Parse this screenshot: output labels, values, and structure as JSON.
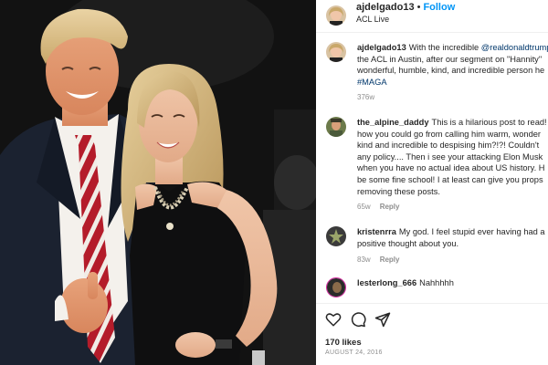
{
  "header": {
    "username": "ajdelgado13",
    "separator": "•",
    "follow_label": "Follow",
    "subtitle": "ACL Live",
    "avatar_icon": "profile-photo"
  },
  "caption": {
    "username": "ajdelgado13",
    "lines": [
      "With the incredible ",
      "the ACL in Austin, after our segment on \"Hannity\"",
      "wonderful, humble, kind, and incredible person he",
      "#MAGA"
    ],
    "mention": "@realdonaldtrump",
    "time": "376w"
  },
  "comments": [
    {
      "username": "the_alpine_daddy",
      "lines": [
        "This is a hilarious post to read!",
        "how you could go from calling him warm, wonder",
        "kind and incredible to despising him?!?! Couldn't",
        "any policy.... Then i see your attacking Elon Musk",
        "when you have no actual idea about US history. H",
        "be some fine school! I at least can give you props",
        "removing these posts."
      ],
      "time": "65w",
      "reply_label": "Reply"
    },
    {
      "username": "kristenrra",
      "lines": [
        "My god. I feel stupid ever having had a",
        "positive thought about you."
      ],
      "time": "83w",
      "reply_label": "Reply"
    },
    {
      "username": "lesterlong_666",
      "lines": [
        "Nahhhhh"
      ],
      "time": "",
      "reply_label": ""
    }
  ],
  "actions": {
    "like_icon": "heart-icon",
    "comment_icon": "comment-icon",
    "share_icon": "share-icon",
    "likes_text": "170 likes",
    "date_text": "AUGUST 24, 2016"
  },
  "colors": {
    "link": "#0095f6",
    "mention": "#00376b",
    "muted": "#8e8e8e",
    "text": "#262626"
  }
}
